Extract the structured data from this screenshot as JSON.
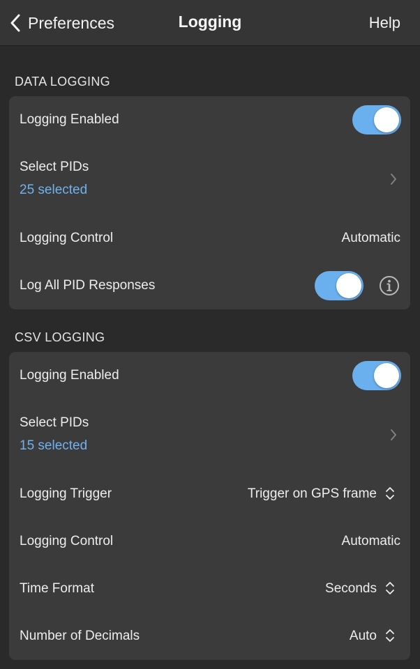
{
  "navbar": {
    "back_label": "Preferences",
    "title": "Logging",
    "help_label": "Help"
  },
  "data_logging": {
    "header": "DATA LOGGING",
    "logging_enabled": {
      "label": "Logging Enabled",
      "on": true
    },
    "select_pids": {
      "label": "Select PIDs",
      "sub": "25 selected"
    },
    "logging_control": {
      "label": "Logging Control",
      "value": "Automatic"
    },
    "log_all": {
      "label": "Log All PID Responses",
      "on": true
    }
  },
  "csv_logging": {
    "header": "CSV LOGGING",
    "logging_enabled": {
      "label": "Logging Enabled",
      "on": true
    },
    "select_pids": {
      "label": "Select PIDs",
      "sub": "15 selected"
    },
    "logging_trigger": {
      "label": "Logging Trigger",
      "value": "Trigger on GPS frame"
    },
    "logging_control": {
      "label": "Logging Control",
      "value": "Automatic"
    },
    "time_format": {
      "label": "Time Format",
      "value": "Seconds"
    },
    "decimals": {
      "label": "Number of Decimals",
      "value": "Auto"
    }
  },
  "icons": {
    "back": "chevron-left-icon",
    "disclosure": "chevron-right-icon",
    "picker": "up-down-chevron-icon",
    "info": "info-circle-icon"
  },
  "colors": {
    "accent": "#6bb0ee",
    "link": "#70b2ee",
    "card": "#3b3b3b",
    "background": "#2a2a2a",
    "navbar": "#353535"
  }
}
